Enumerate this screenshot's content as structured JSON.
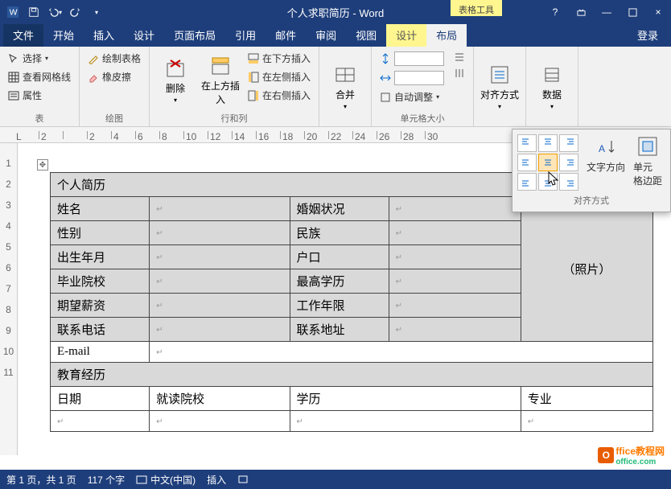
{
  "title": "个人求职简历 - Word",
  "table_tools": "表格工具",
  "qat": {
    "word_icon": "w",
    "save": "save",
    "undo": "undo",
    "redo": "redo"
  },
  "win": {
    "help": "?",
    "ribbon": "▭",
    "min": "—",
    "max": "□",
    "close": "×"
  },
  "tabs": {
    "file": "文件",
    "home": "开始",
    "insert": "插入",
    "design": "设计",
    "layout": "页面布局",
    "references": "引用",
    "mailings": "邮件",
    "review": "审阅",
    "view": "视图",
    "ctx_design": "设计",
    "ctx_layout": "布局",
    "login": "登录"
  },
  "ribbon": {
    "table_group": {
      "select": "选择",
      "gridlines": "查看网格线",
      "properties": "属性",
      "label": "表"
    },
    "draw_group": {
      "draw": "绘制表格",
      "eraser": "橡皮擦",
      "label": "绘图"
    },
    "rows_group": {
      "delete": "删除",
      "insert_above": "在上方插入",
      "insert_below": "在下方插入",
      "insert_left": "在左侧插入",
      "insert_right": "在右侧插入",
      "label": "行和列"
    },
    "merge_group": {
      "merge": "合并",
      "label": ""
    },
    "size_group": {
      "autofit": "自动调整",
      "label": "单元格大小"
    },
    "align_group": {
      "align": "对齐方式",
      "label": ""
    },
    "data_group": {
      "data": "数据",
      "label": ""
    }
  },
  "popover": {
    "text_dir": "文字方向",
    "margins": "单元\n格边距",
    "label": "对齐方式"
  },
  "ruler_h": [
    "2",
    "",
    "2",
    "4",
    "6",
    "8",
    "10",
    "12",
    "14",
    "16",
    "18",
    "20",
    "22",
    "24",
    "26",
    "28",
    "30"
  ],
  "ruler_v": [
    "",
    "1",
    "2",
    "3",
    "4",
    "5",
    "6",
    "7",
    "8",
    "9",
    "10",
    "11",
    ""
  ],
  "resume": {
    "r1": "个人简历",
    "r2": {
      "c1": "姓名",
      "c2": "婚姻状况",
      "photo": "（照片）"
    },
    "r3": {
      "c1": "性别",
      "c2": "民族"
    },
    "r4": {
      "c1": "出生年月",
      "c2": "户口"
    },
    "r5": {
      "c1": "毕业院校",
      "c2": "最高学历"
    },
    "r6": {
      "c1": "期望薪资",
      "c2": "工作年限"
    },
    "r7": {
      "c1": "联系电话",
      "c2": "联系地址"
    },
    "r8": {
      "c1": "E-mail"
    },
    "r9": "教育经历",
    "r10": {
      "c1": "日期",
      "c2": "就读院校",
      "c3": "学历",
      "c4": "专业"
    }
  },
  "status": {
    "page": "第 1 页，共 1 页",
    "words": "117 个字",
    "lang": "中文(中国)",
    "mode": "插入"
  },
  "watermark": {
    "text": "ffice教程网",
    "sub": "office.com"
  }
}
